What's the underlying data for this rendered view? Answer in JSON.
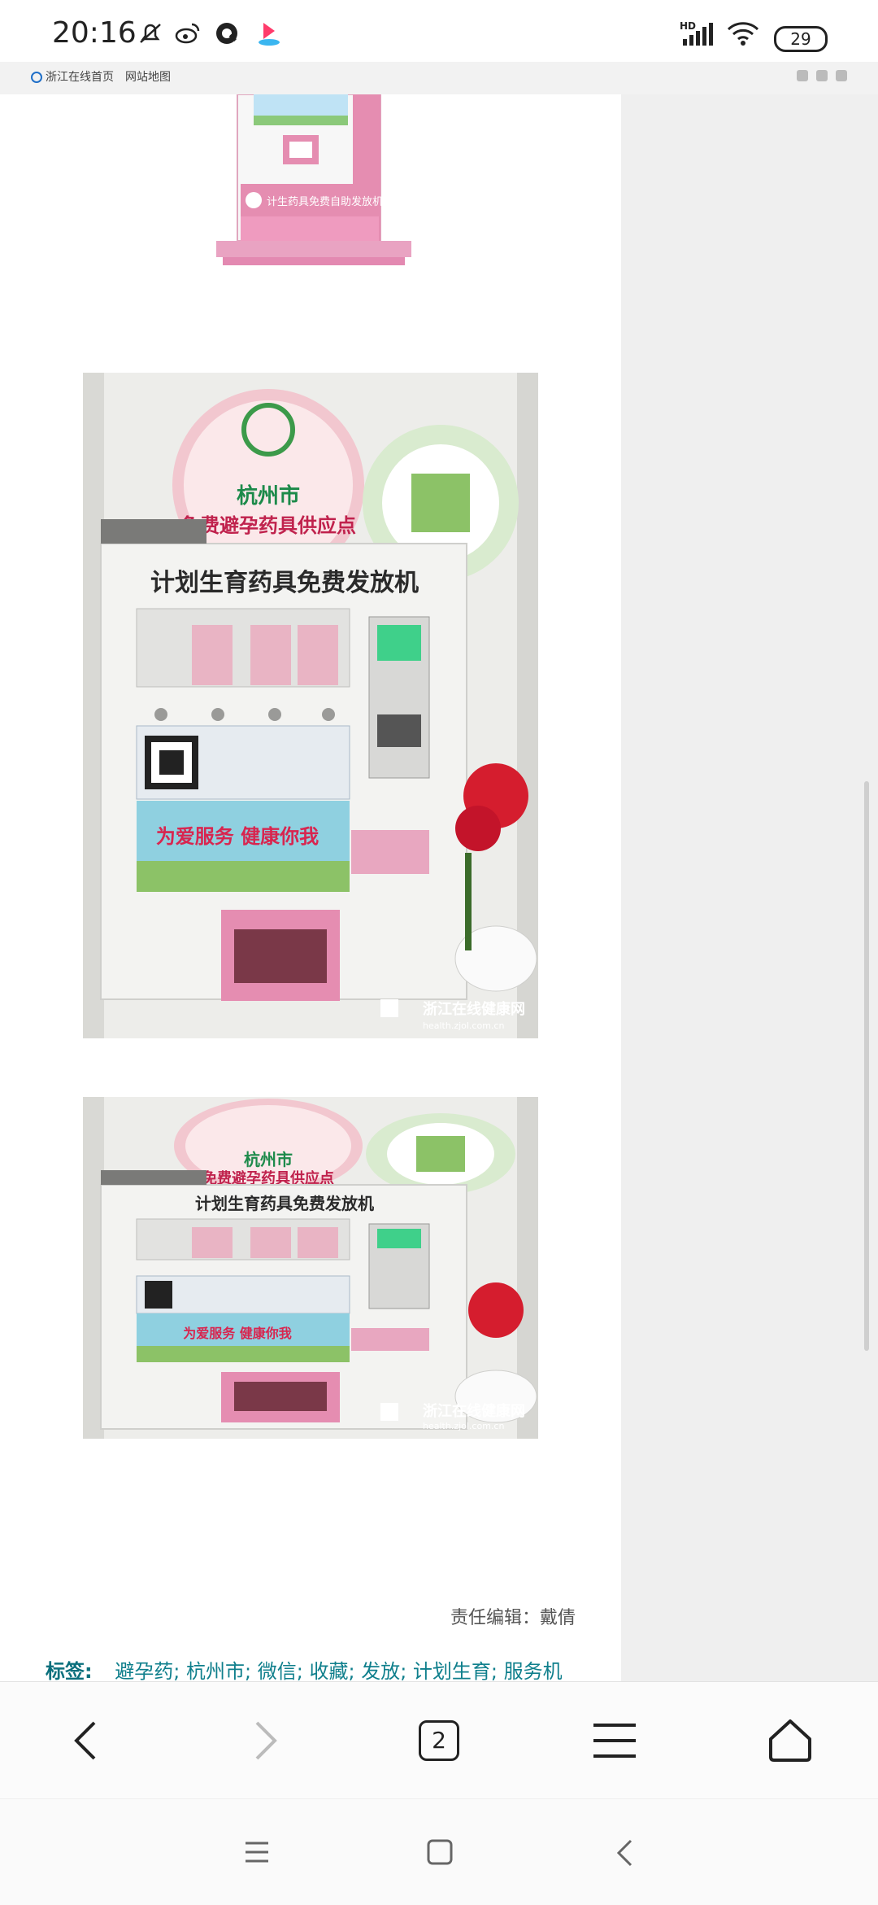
{
  "status_bar": {
    "time": "20:16",
    "battery": "29",
    "network": "HD"
  },
  "site_header": {
    "home_link": "浙江在线首页",
    "sitemap_link": "网站地图"
  },
  "images": [
    {
      "caption": "计划生育药具免费发放机",
      "sign_city": "杭州市",
      "sign_text": "免费避孕药具供应点",
      "slogan": "为爱服务  健康你我",
      "watermark": "浙江在线健康网",
      "watermark_url": "health.zjol.com.cn"
    },
    {
      "caption": "计划生育药具免费发放机",
      "sign_city": "杭州市",
      "sign_text": "免费避孕药具供应点",
      "slogan": "为爱服务  健康你我",
      "watermark": "浙江在线健康网",
      "watermark_url": "health.zjol.com.cn"
    }
  ],
  "top_machine_label": "计生药具免费自助发放机",
  "editor": {
    "label": "责任编辑：",
    "name": "戴倩"
  },
  "tags": {
    "label": "标签:",
    "items": [
      "避孕药",
      "杭州市",
      "微信",
      "收藏",
      "发放",
      "计划生育",
      "服务机"
    ]
  },
  "browser_bar": {
    "tab_count": "2"
  },
  "colors": {
    "tag_teal": "#0f7f8c",
    "machine_pink": "#e8a0b8",
    "machine_white": "#f3f3f1"
  }
}
